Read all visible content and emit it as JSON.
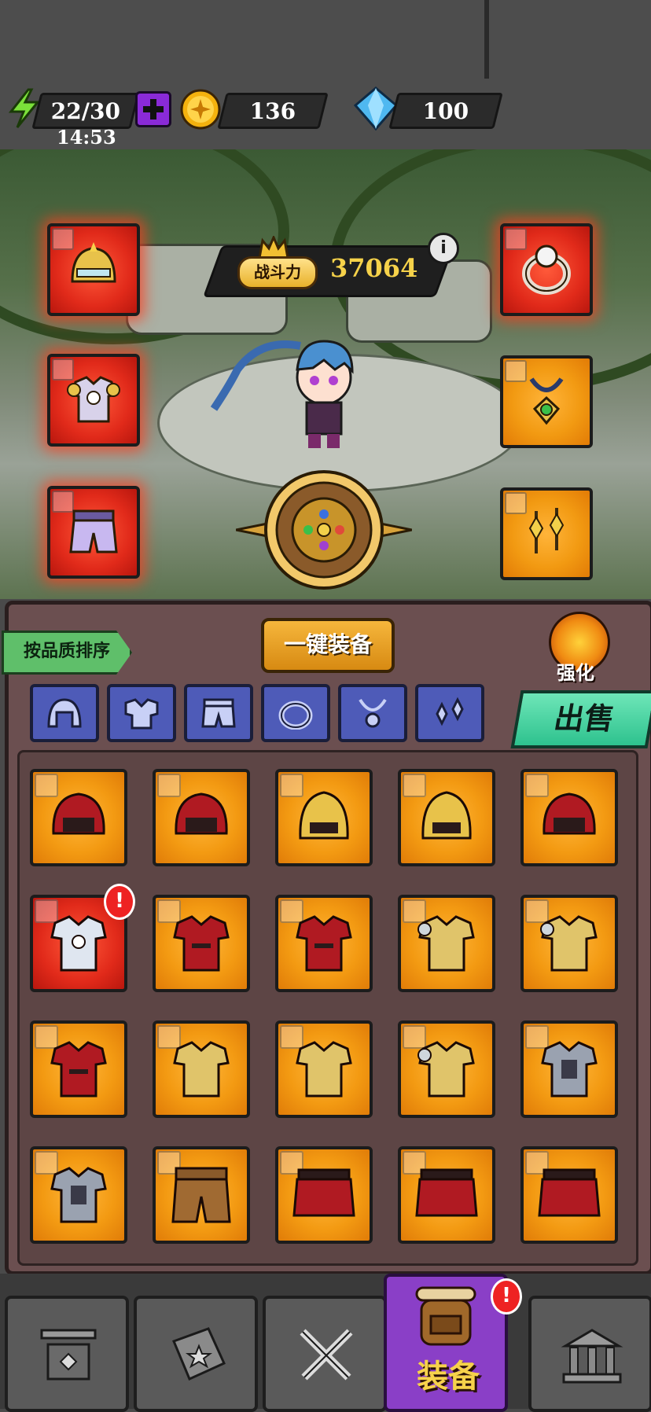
{
  "status_bar": {
    "energy": "22/30",
    "energy_timer": "14:53",
    "coins": "136",
    "gems": "100"
  },
  "hero": {
    "power_label": "战斗力",
    "power_value": "37064"
  },
  "bag": {
    "sort_label": "按品质排序",
    "equip_all_label": "一键装备",
    "strengthen_label": "强化",
    "sell_label": "出售"
  },
  "nav": {
    "active_label": "装备"
  },
  "colors": {
    "rarity_orange": "#f39a12",
    "rarity_red": "#e12a1a",
    "sell_green": "#2ec28e",
    "nav_active": "#8a3fc7"
  },
  "filters": [
    "helmet-icon",
    "armor-icon",
    "pants-icon",
    "ring-icon",
    "necklace-icon",
    "earring-icon"
  ],
  "equipped": {
    "left": [
      {
        "icon": "helmet-icon",
        "rarity": "red"
      },
      {
        "icon": "armor-icon",
        "rarity": "red"
      },
      {
        "icon": "pants-icon",
        "rarity": "red"
      }
    ],
    "right": [
      {
        "icon": "ring-icon",
        "rarity": "red"
      },
      {
        "icon": "necklace-icon",
        "rarity": "orange"
      },
      {
        "icon": "earring-icon",
        "rarity": "orange"
      }
    ]
  },
  "inventory_rows": [
    [
      "helmet-icon",
      "helmet-icon",
      "helmet-icon",
      "helmet-icon",
      "helmet-icon"
    ],
    [
      "armor-icon",
      "armor-icon",
      "armor-icon",
      "armor-icon",
      "armor-icon"
    ],
    [
      "armor-icon",
      "armor-icon",
      "armor-icon",
      "armor-icon",
      "armor-icon"
    ],
    [
      "armor-icon",
      "pants-icon",
      "pants-icon",
      "pants-icon",
      "pants-icon"
    ]
  ]
}
